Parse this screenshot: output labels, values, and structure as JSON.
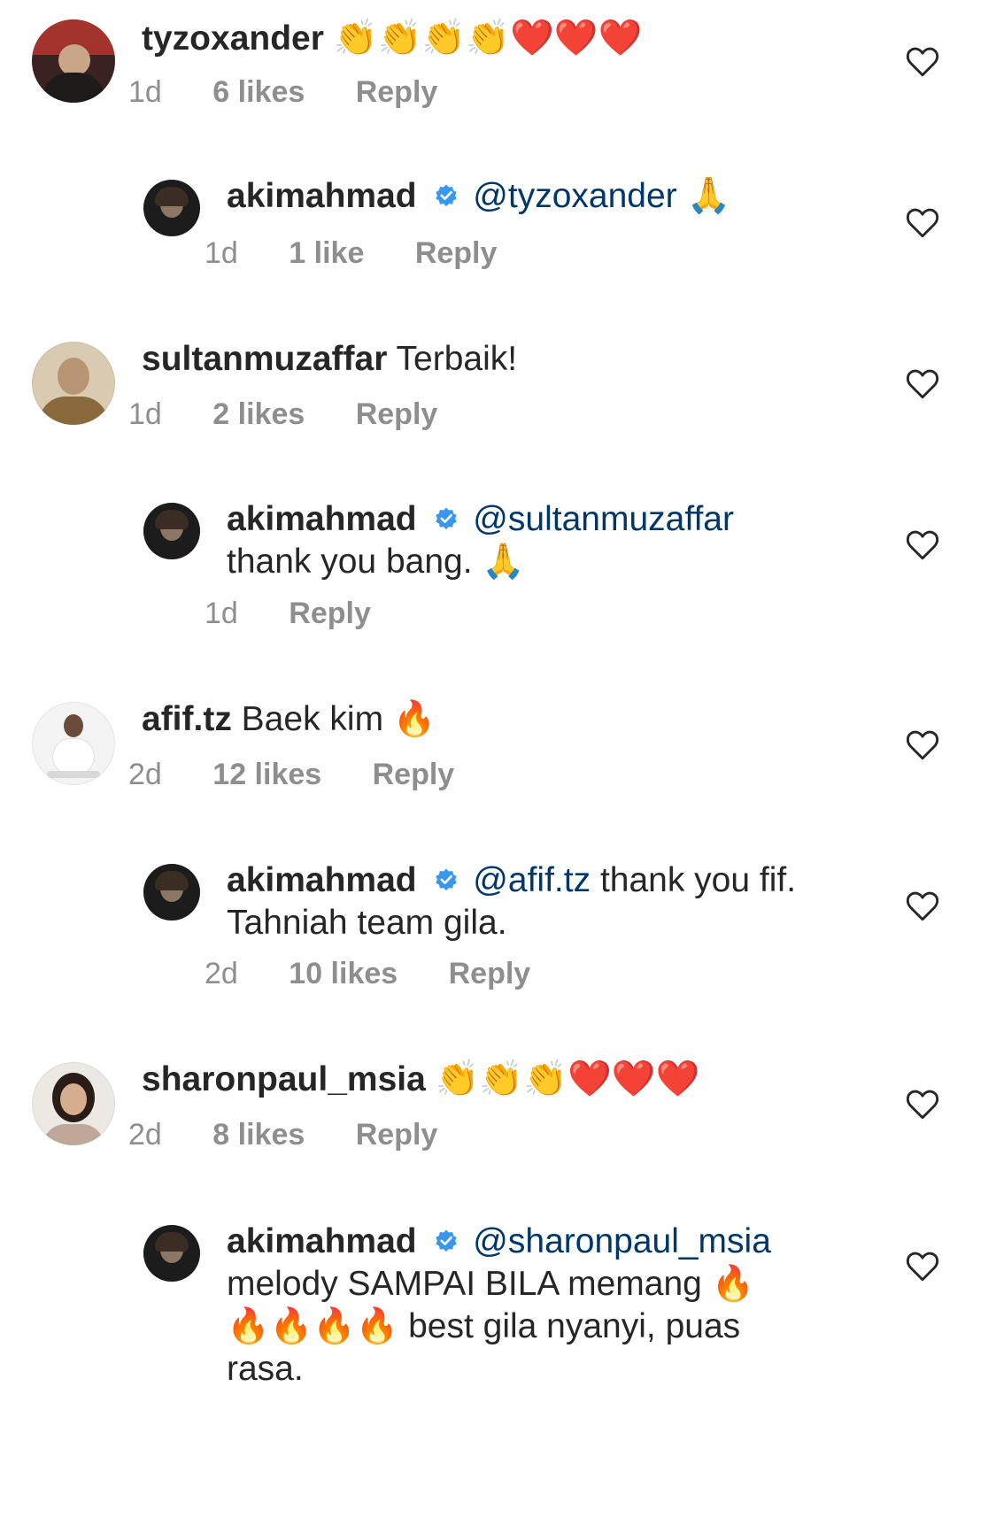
{
  "comments": [
    {
      "username": "tyzoxander",
      "text": "👏👏👏👏❤️❤️❤️",
      "meta": {
        "time": "1d",
        "likes": "6 likes",
        "reply": "Reply"
      }
    },
    {
      "username": "akimahmad",
      "mention": "@tyzoxander",
      "text": "🙏",
      "meta": {
        "time": "1d",
        "likes": "1 like",
        "reply": "Reply"
      }
    },
    {
      "username": "sultanmuzaffar",
      "text": "Terbaik!",
      "meta": {
        "time": "1d",
        "likes": "2 likes",
        "reply": "Reply"
      }
    },
    {
      "username": "akimahmad",
      "mention": "@sultanmuzaffar",
      "text": "thank you bang. 🙏",
      "meta": {
        "time": "1d",
        "reply": "Reply"
      }
    },
    {
      "username": "afif.tz",
      "text": "Baek kim 🔥",
      "meta": {
        "time": "2d",
        "likes": "12 likes",
        "reply": "Reply"
      }
    },
    {
      "username": "akimahmad",
      "mention": "@afif.tz",
      "text": "thank you fif. Tahniah team gila.",
      "meta": {
        "time": "2d",
        "likes": "10 likes",
        "reply": "Reply"
      }
    },
    {
      "username": "sharonpaul_msia",
      "text": "👏👏👏❤️❤️❤️",
      "meta": {
        "time": "2d",
        "likes": "8 likes",
        "reply": "Reply"
      }
    },
    {
      "username": "akimahmad",
      "mention": "@sharonpaul_msia",
      "text": "melody SAMPAI BILA memang 🔥🔥🔥🔥🔥 best gila nyanyi, puas rasa."
    }
  ],
  "colors": {
    "username": "#262626",
    "mention": "#00376b",
    "meta": "#8e8e8e",
    "verified": "#3897f0"
  },
  "icons": {
    "like": "heart-outline-icon",
    "verified": "verified-badge-icon"
  }
}
